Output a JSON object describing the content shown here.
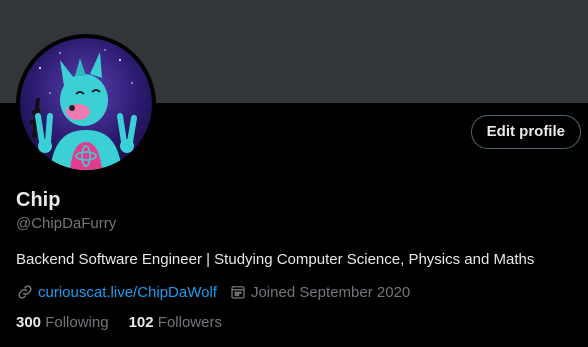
{
  "profile": {
    "name": "Chip",
    "handle": "@ChipDaFurry",
    "bio": "Backend Software Engineer | Studying Computer Science, Physics and Maths",
    "website": "curiouscat.live/ChipDaWolf",
    "joined": "Joined September 2020"
  },
  "actions": {
    "edit_profile_label": "Edit profile"
  },
  "stats": {
    "following_count": "300",
    "following_label": "Following",
    "followers_count": "102",
    "followers_label": "Followers"
  },
  "icons": {
    "link": "link-icon",
    "calendar": "calendar-icon"
  },
  "colors": {
    "background": "#000000",
    "banner": "#333639",
    "text_primary": "#e7e9ea",
    "text_secondary": "#71767b",
    "link": "#1d9bf0",
    "button_border": "#536471"
  }
}
